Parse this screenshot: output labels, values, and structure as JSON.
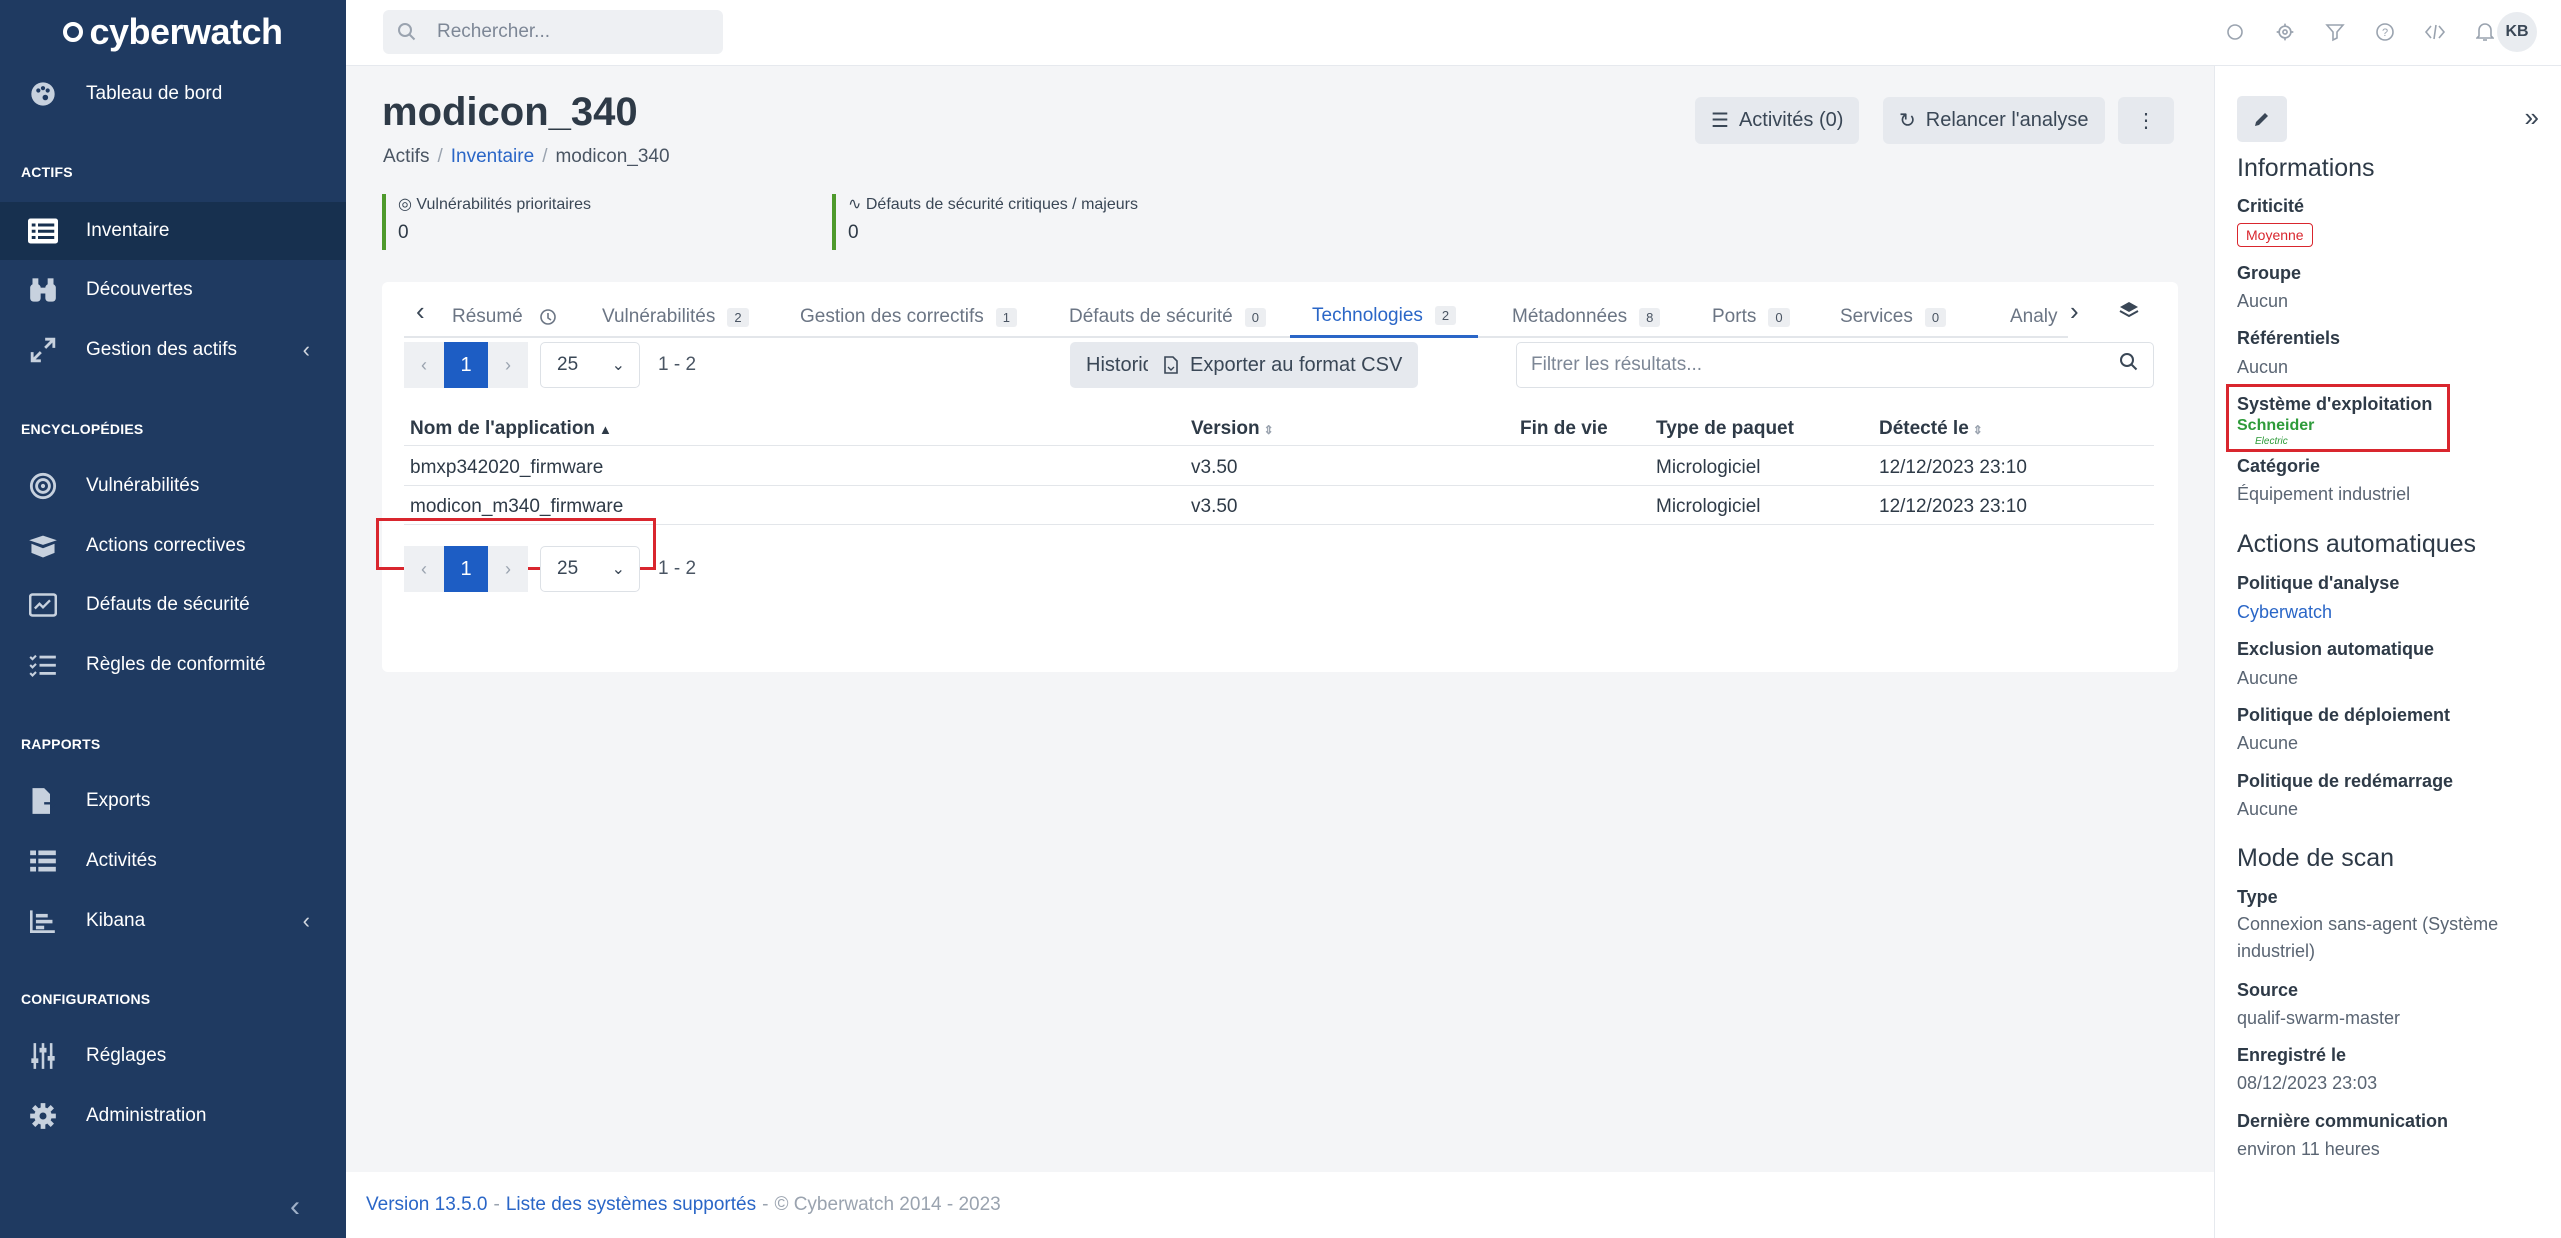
{
  "sidebar": {
    "logo": "cyberwatch",
    "items": {
      "dashboard": "Tableau de bord",
      "inventory": "Inventaire",
      "discoveries": "Découvertes",
      "asset_mgmt": "Gestion des actifs",
      "vulnerabilities": "Vulnérabilités",
      "corrective": "Actions correctives",
      "security_defaults": "Défauts de sécurité",
      "compliance": "Règles de conformité",
      "exports": "Exports",
      "activities": "Activités",
      "kibana": "Kibana",
      "settings": "Réglages",
      "administration": "Administration"
    },
    "sections": {
      "actifs": "ACTIFS",
      "encyclopedies": "ENCYCLOPÉDIES",
      "rapports": "RAPPORTS",
      "configurations": "CONFIGURATIONS"
    }
  },
  "topbar": {
    "search_placeholder": "Rechercher...",
    "user_initials": "KB"
  },
  "page": {
    "title": "modicon_340",
    "breadcrumb": [
      "Actifs",
      "Inventaire",
      "modicon_340"
    ],
    "activities_btn": "Activités (0)",
    "rerun_btn": "Relancer l'analyse",
    "kpi": {
      "priority_label": "Vulnérabilités prioritaires",
      "priority_value": "0",
      "critical_label": "Défauts de sécurité critiques / majeurs",
      "critical_value": "0"
    }
  },
  "tabs": [
    {
      "label": "Résumé",
      "count": ""
    },
    {
      "label": "Vulnérabilités",
      "count": "2"
    },
    {
      "label": "Gestion des correctifs",
      "count": "1"
    },
    {
      "label": "Défauts de sécurité",
      "count": "0"
    },
    {
      "label": "Technologies",
      "count": "2"
    },
    {
      "label": "Métadonnées",
      "count": "8"
    },
    {
      "label": "Ports",
      "count": "0"
    },
    {
      "label": "Services",
      "count": "0"
    },
    {
      "label": "Analy",
      "count": ""
    }
  ],
  "table": {
    "page": "1",
    "per_page": "25",
    "range": "1 - 2",
    "history_btn": "Historique",
    "export_btn": "Exporter au format CSV",
    "filter_placeholder": "Filtrer les résultats...",
    "columns": [
      "Nom de l'application",
      "Version",
      "Fin de vie",
      "Type de paquet",
      "Détecté le"
    ],
    "rows": [
      [
        "bmxp342020_firmware",
        "v3.50",
        "",
        "Micrologiciel",
        "12/12/2023 23:10"
      ],
      [
        "modicon_m340_firmware",
        "v3.50",
        "",
        "Micrologiciel",
        "12/12/2023 23:10"
      ]
    ]
  },
  "footer": {
    "version": "Version 13.5.0",
    "supported": "Liste des systèmes supportés",
    "copyright": "© Cyberwatch 2014 - 2023"
  },
  "panel": {
    "informations": "Informations",
    "criticite_label": "Criticité",
    "criticite_value": "Moyenne",
    "groupe_label": "Groupe",
    "groupe_value": "Aucun",
    "referentiels_label": "Référentiels",
    "referentiels_value": "Aucun",
    "os_label": "Système d'exploitation",
    "os_logo_text": "Schneider",
    "os_logo_sub": "Electric",
    "categorie_label": "Catégorie",
    "categorie_value": "Équipement industriel",
    "actions_auto": "Actions automatiques",
    "politique_analyse_label": "Politique d'analyse",
    "politique_analyse_value": "Cyberwatch",
    "exclusion_label": "Exclusion automatique",
    "exclusion_value": "Aucune",
    "deploiement_label": "Politique de déploiement",
    "deploiement_value": "Aucune",
    "redemarrage_label": "Politique de redémarrage",
    "redemarrage_value": "Aucune",
    "mode_scan": "Mode de scan",
    "type_label": "Type",
    "type_value": "Connexion sans-agent (Système industriel)",
    "source_label": "Source",
    "source_value": "qualif-swarm-master",
    "enregistre_label": "Enregistré le",
    "enregistre_value": "08/12/2023 23:03",
    "derniere_label": "Dernière communication",
    "derniere_value": "environ 11 heures"
  },
  "colors": {
    "sidebar": "#1f3a61",
    "accent": "#2a66c7",
    "highlight": "#d9262e",
    "kpi_bar": "#4e9a2c"
  }
}
